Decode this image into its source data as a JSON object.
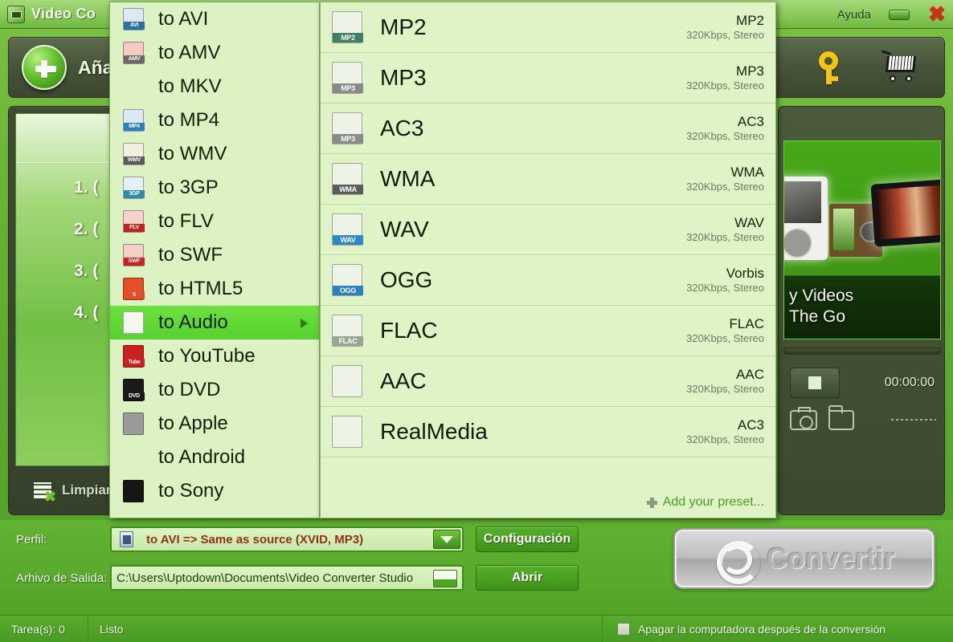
{
  "window": {
    "title": "Video Co",
    "help_label": "Ayuda",
    "minimize_label": "",
    "close_label": "✖"
  },
  "toolbar": {
    "add_label": "Aña",
    "key_icon": "key-icon",
    "cart_icon": "cart-icon"
  },
  "filepanel": {
    "rows": [
      "1.  (",
      "2.  (",
      "3.  (",
      "4.  ("
    ],
    "clear_label": "Limpiar"
  },
  "preview": {
    "caption_line1": "y Videos",
    "caption_line2": "The Go",
    "time": "00:00:00",
    "stop_icon": "stop-icon",
    "snapshot_icon": "camera-icon",
    "folder_icon": "folder-icon"
  },
  "bottom": {
    "profile_label": "Perfil:",
    "profile_value": "to AVI => Same as source (XVID, MP3)",
    "output_label": "Arhivo de Salida:",
    "output_value": "C:\\Users\\Uptodown\\Documents\\Video Converter Studio",
    "config_button": "Configuración",
    "open_button": "Abrir",
    "convert_button": "Convertir"
  },
  "status": {
    "tasks": "Tarea(s): 0",
    "ready": "Listo",
    "shutdown_label": "Apagar la computadora después de la conversión"
  },
  "menu_formats": {
    "items": [
      {
        "label": "to AVI",
        "icon": "avi-file-icon",
        "tag": "AVI",
        "tag_color": "#2e6fa8",
        "body_color": "#dce8f4",
        "active": false
      },
      {
        "label": "to AMV",
        "icon": "amv-file-icon",
        "tag": "AMV",
        "tag_color": "#6a6a6a",
        "body_color": "#f6c9c4",
        "active": false
      },
      {
        "label": "to MKV",
        "icon": "mkv-braces-icon",
        "tag": "",
        "tag_color": "#1d6ea8",
        "body_color": "transparent",
        "active": false
      },
      {
        "label": "to MP4",
        "icon": "mp4-file-icon",
        "tag": "MP4",
        "tag_color": "#2e7ec0",
        "body_color": "#dbe9f7",
        "active": false
      },
      {
        "label": "to WMV",
        "icon": "wmv-file-icon",
        "tag": "WMV",
        "tag_color": "#5a5a5a",
        "body_color": "#f3f0e2",
        "active": false
      },
      {
        "label": "to 3GP",
        "icon": "3gp-file-icon",
        "tag": "3GP",
        "tag_color": "#2f8aa8",
        "body_color": "#e6eef5",
        "active": false
      },
      {
        "label": "to FLV",
        "icon": "flv-file-icon",
        "tag": "FLV",
        "tag_color": "#c3241e",
        "body_color": "#f6d2cd",
        "active": false
      },
      {
        "label": "to SWF",
        "icon": "swf-file-icon",
        "tag": "SWF",
        "tag_color": "#c3241e",
        "body_color": "#f3cfc9",
        "active": false
      },
      {
        "label": "to HTML5",
        "icon": "html5-icon",
        "tag": "5",
        "tag_color": "#e34f26",
        "body_color": "#e34f26",
        "active": false
      },
      {
        "label": "to Audio",
        "icon": "audio-note-icon",
        "tag": "",
        "tag_color": "#4a8a2a",
        "body_color": "#f4f8ef",
        "active": true
      },
      {
        "label": "to YouTube",
        "icon": "youtube-icon",
        "tag": "Tube",
        "tag_color": "#cc1f1f",
        "body_color": "#cc1f1f",
        "active": false
      },
      {
        "label": "to DVD",
        "icon": "dvd-icon",
        "tag": "DVD",
        "tag_color": "#1a1a1a",
        "body_color": "#1a1a1a",
        "active": false
      },
      {
        "label": "to Apple",
        "icon": "apple-icon",
        "tag": "",
        "tag_color": "#888888",
        "body_color": "#9a9a9a",
        "active": false
      },
      {
        "label": "to Android",
        "icon": "android-icon",
        "tag": "",
        "tag_color": "#8cc63f",
        "body_color": "transparent",
        "active": false
      },
      {
        "label": "to Sony",
        "icon": "playstation-icon",
        "tag": "",
        "tag_color": "#111111",
        "body_color": "#161616",
        "active": false
      }
    ]
  },
  "menu_audio": {
    "items": [
      {
        "name": "MP2",
        "codec": "MP2",
        "bitrate": "320Kbps, Stereo",
        "icon": "mp2-file-icon",
        "tag": "MP2",
        "tag_color": "#3f7f63"
      },
      {
        "name": "MP3",
        "codec": "MP3",
        "bitrate": "320Kbps, Stereo",
        "icon": "mp3-file-icon",
        "tag": "MP3",
        "tag_color": "#8a8a8a"
      },
      {
        "name": "AC3",
        "codec": "AC3",
        "bitrate": "320Kbps, Stereo",
        "icon": "mp3-file-icon",
        "tag": "MP3",
        "tag_color": "#8a8a8a"
      },
      {
        "name": "WMA",
        "codec": "WMA",
        "bitrate": "320Kbps, Stereo",
        "icon": "wma-file-icon",
        "tag": "WMA",
        "tag_color": "#5c5c5c"
      },
      {
        "name": "WAV",
        "codec": "WAV",
        "bitrate": "320Kbps, Stereo",
        "icon": "wav-file-icon",
        "tag": "WAV",
        "tag_color": "#2f8ac4"
      },
      {
        "name": "OGG",
        "codec": "Vorbis",
        "bitrate": "320Kbps, Stereo",
        "icon": "ogg-file-icon",
        "tag": "OGG",
        "tag_color": "#2f7fc4"
      },
      {
        "name": "FLAC",
        "codec": "FLAC",
        "bitrate": "320Kbps, Stereo",
        "icon": "flac-file-icon",
        "tag": "FLAC",
        "tag_color": "#9aa694"
      },
      {
        "name": "AAC",
        "codec": "AAC",
        "bitrate": "320Kbps, Stereo",
        "icon": "aac-file-icon",
        "tag": "",
        "tag_color": "#6aa83a"
      },
      {
        "name": "RealMedia",
        "codec": "AC3",
        "bitrate": "320Kbps, Stereo",
        "icon": "real-file-icon",
        "tag": "",
        "tag_color": "#6aa83a"
      }
    ],
    "add_preset": "Add your preset..."
  },
  "colors": {
    "menu_bg": "#dcf2c2",
    "menu_highlight": "#56d12f",
    "accent_green": "#4d9a2b",
    "profile_text": "#8c3318"
  }
}
